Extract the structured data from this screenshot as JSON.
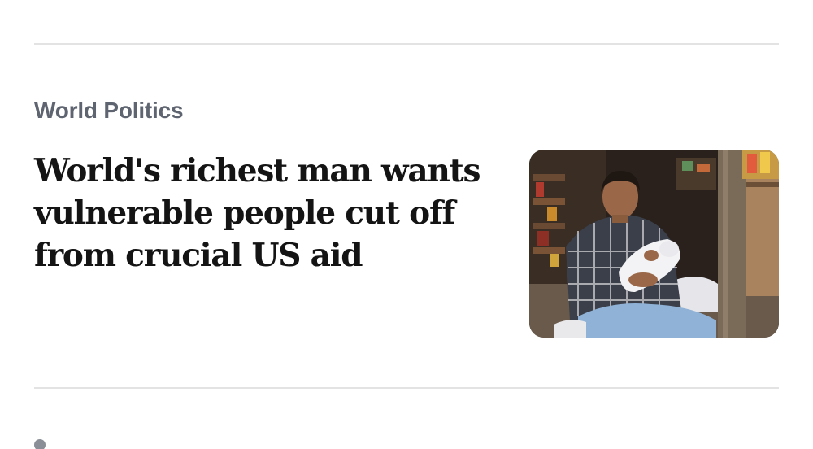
{
  "article": {
    "section": "World Politics",
    "headline": "World's richest man wants vulnerable people cut off from crucial US aid",
    "thumbnail_alt": "Woman holding a baby wrapped in white cloth outside a shop"
  },
  "colors": {
    "section_text": "#5f6570",
    "headline_text": "#141414",
    "divider": "#e3e3e3"
  }
}
